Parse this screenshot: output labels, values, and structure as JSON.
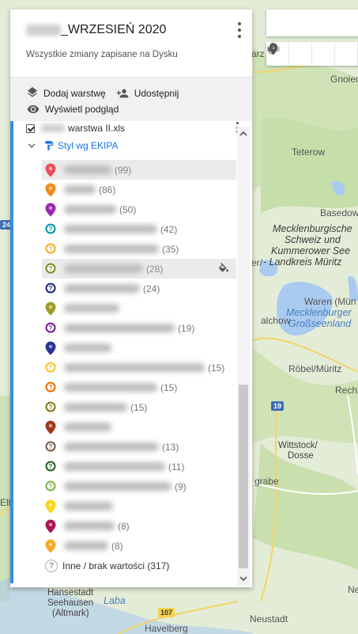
{
  "map_title_suffix": "_WRZESIEŃ 2020",
  "save_status": "Wszystkie zmiany zapisane na Dysku",
  "actions": {
    "add_layer": "Dodaj warstwę",
    "share": "Udostępnij",
    "preview": "Wyświetl podgląd"
  },
  "layer": {
    "name": "warstwa II.xls",
    "style_label": "Styl wg EKIPA"
  },
  "legend": [
    {
      "count": "(99)",
      "color": "#e8505b",
      "glyph": "dot"
    },
    {
      "count": "(86)",
      "color": "#f08a1c",
      "glyph": "dot"
    },
    {
      "count": "(50)",
      "color": "#9c27b0",
      "glyph": "dot"
    },
    {
      "count": "(42)",
      "color": "#0097a7",
      "glyph": "?"
    },
    {
      "count": "(35)",
      "color": "#f9a825",
      "glyph": "?"
    },
    {
      "count": "(28)",
      "color": "#7c8b23",
      "glyph": "?"
    },
    {
      "count": "(24)",
      "color": "#1a237e",
      "glyph": "?"
    },
    {
      "count": "",
      "color": "#9e9d24",
      "glyph": "dot"
    },
    {
      "count": "(19)",
      "color": "#6a1b9a",
      "glyph": "?"
    },
    {
      "count": "",
      "color": "#283593",
      "glyph": "dot"
    },
    {
      "count": "(15)",
      "color": "#fbc02d",
      "glyph": "?"
    },
    {
      "count": "(15)",
      "color": "#ef6c00",
      "glyph": "?"
    },
    {
      "count": "(15)",
      "color": "#827717",
      "glyph": "?"
    },
    {
      "count": "",
      "color": "#a1361e",
      "glyph": "dot"
    },
    {
      "count": "(13)",
      "color": "#795548",
      "glyph": "?"
    },
    {
      "count": "(11)",
      "color": "#1b5e20",
      "glyph": "?"
    },
    {
      "count": "(9)",
      "color": "#7cb342",
      "glyph": "?"
    },
    {
      "count": "",
      "color": "#f9d71c",
      "glyph": "dot"
    },
    {
      "count": "(8)",
      "color": "#ad1457",
      "glyph": "dot"
    },
    {
      "count": "(8)",
      "color": "#f9a825",
      "glyph": "dot"
    }
  ],
  "other_label": "Inne / brak wartości (317)",
  "map_labels": {
    "teterow": "Teterow",
    "basedow": "Basedow",
    "gnoien": "Gnoier",
    "mecklenburgische": "Mecklenburgische",
    "schweiz": "Schweiz und",
    "kummerower": "Kummerower See",
    "landkreis": "- Landkreis Müritz",
    "waren": "Waren (Müri",
    "mecklenburger": "Mecklenburger",
    "grosseenland": "Großseenland",
    "robel": "Röbel/Müritz",
    "rechl": "Rechl",
    "wittstock": "Wittstock/",
    "dosse": "Dosse",
    "hansestadt": "Hansestadt",
    "seehausen": "Seehausen",
    "altmark": "(Altmark)",
    "neustadt": "Neustadt",
    "havelberg": "Havelberg",
    "alchow": "alchow",
    "grabe": "grabe",
    "ne": "Ne",
    "laba": "Laba",
    "elb": "Elb",
    "arz": "arz",
    "er": "er/",
    "road_19": "19",
    "road_107": "107",
    "road_24": "24"
  }
}
